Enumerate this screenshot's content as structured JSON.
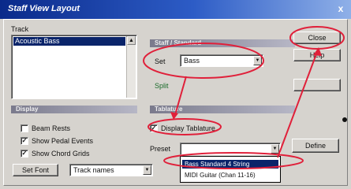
{
  "window": {
    "title": "Staff View Layout",
    "close_glyph": "x"
  },
  "track": {
    "label": "Track",
    "items": [
      "Acoustic Bass"
    ]
  },
  "staff_group": {
    "header": "Staff / Standard",
    "set_label": "Set",
    "set_value": "Bass",
    "split_label": "Split"
  },
  "display_group": {
    "header": "Display",
    "beam_rests": "Beam Rests",
    "show_pedal_events": "Show Pedal Events",
    "show_chord_grids": "Show Chord Grids",
    "beam_rests_checked": false,
    "show_pedal_events_checked": true,
    "show_chord_grids_checked": true
  },
  "fonts": {
    "set_font_button": "Set Font",
    "font_select": "Track names"
  },
  "tablature_group": {
    "header": "Tablature",
    "display_label": "Display Tablature",
    "display_checked": true,
    "preset_label": "Preset",
    "define_button": "Define",
    "preset_options": [
      "Bass Standard 4 String",
      "MIDI Guitar (Chan 11-16)"
    ]
  },
  "buttons": {
    "close": "Close",
    "help": "Help"
  },
  "annotation_color": "#e0203a"
}
